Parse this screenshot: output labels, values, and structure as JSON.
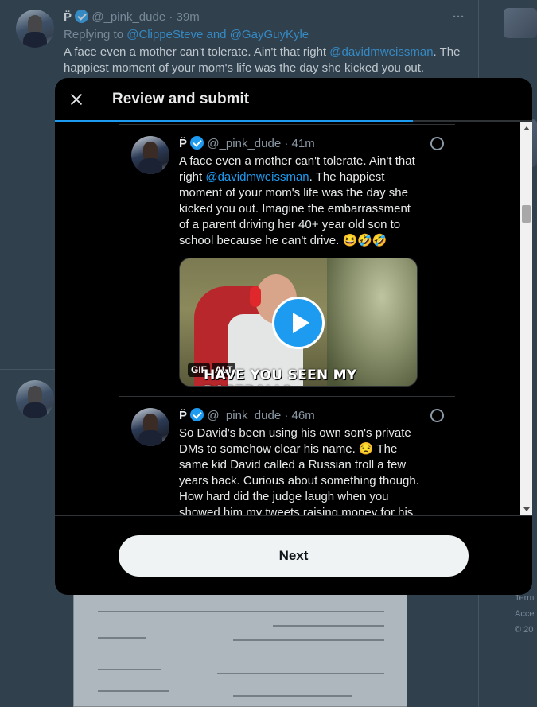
{
  "colors": {
    "accent": "#1d9bf0",
    "background": "#15202b",
    "modal_bg": "#000000"
  },
  "background_tweet": {
    "name_glyph": "P̈",
    "handle": "@_pink_dude",
    "time": "39m",
    "more": "···",
    "replying_prefix": "Replying to",
    "reply_user1": "@ClippeSteve",
    "reply_and": "and",
    "reply_user2": "@GayGuyKyle",
    "text_part1": "A face even a mother can't tolerate. Ain't that right",
    "text_mention": "@davidmweissman",
    "text_part2": ". The happiest moment of your mom's life was the day she kicked you out."
  },
  "right_column": {
    "footer_lines": [
      "Term",
      "Acce",
      "© 20"
    ]
  },
  "modal": {
    "title": "Review and submit",
    "close_icon": "close-icon",
    "progress": 0.75,
    "next_label": "Next"
  },
  "review_items": [
    {
      "name_glyph": "P̈",
      "handle": "@_pink_dude",
      "time": "· 41m",
      "text_part1": "A face even a mother can't tolerate. Ain't that right ",
      "mention": "@davidmweissman",
      "text_part2": ". The happiest moment of your mom's life was the day she kicked you out. Imagine the embarrassment of a parent driving her 40+ year old son to school because he can't drive. 😆🤣🤣",
      "media": {
        "caption": "HAVE YOU SEEN MY BASEBALL?",
        "gif_label": "GIF",
        "alt_label": "ALT"
      }
    },
    {
      "name_glyph": "P̈",
      "handle": "@_pink_dude",
      "time": "· 46m",
      "text": "So David's been using his own son's private DMs to somehow clear his name. 😒 The same kid David called a Russian troll a few years back. Curious about something though. How hard did the judge laugh when you showed him my tweets raising money for his"
    }
  ]
}
